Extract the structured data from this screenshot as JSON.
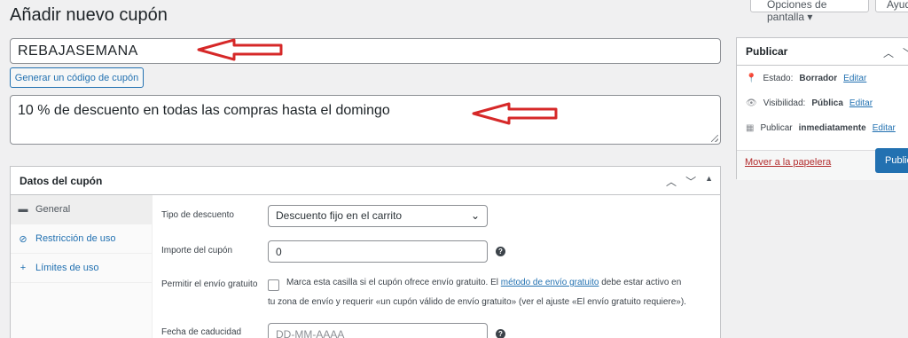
{
  "top": {
    "screen_options": "Opciones de pantalla ▾",
    "help": "Ayuda"
  },
  "page": {
    "title": "Añadir nuevo cupón",
    "coupon_code": "REBAJASEMANA",
    "generate_button": "Generar un código de cupón",
    "description": "10 % de descuento en todas las compras hasta el domingo"
  },
  "coupon_data": {
    "title": "Datos del cupón",
    "tabs": [
      {
        "label": "General",
        "icon": "ticket-icon",
        "glyph": "▬"
      },
      {
        "label": "Restricción de uso",
        "icon": "prohibited-icon",
        "glyph": "⊘"
      },
      {
        "label": "Límites de uso",
        "icon": "plus-icon",
        "glyph": "+"
      }
    ],
    "discount_type_label": "Tipo de descuento",
    "discount_type_value": "Descuento fijo en el carrito",
    "amount_label": "Importe del cupón",
    "amount_value": "0",
    "free_shipping_label": "Permitir el envío gratuito",
    "free_shipping_text_1": "Marca esta casilla si el cupón ofrece envío gratuito. El",
    "free_shipping_link": "método de envío gratuito",
    "free_shipping_text_2": "debe estar activo en",
    "free_shipping_text_3": "tu zona de envío y requerir «un cupón válido de envío gratuito» (ver el ajuste «El envío gratuito requiere»).",
    "expiry_label": "Fecha de caducidad",
    "expiry_placeholder": "DD-MM-AAAA"
  },
  "publish": {
    "title": "Publicar",
    "status_label": "Estado:",
    "status_value": "Borrador",
    "visibility_label": "Visibilidad:",
    "visibility_value": "Pública",
    "schedule_label": "Publicar",
    "schedule_value": "inmediatamente",
    "edit": "Editar",
    "trash": "Mover a la papelera",
    "publish_button": "Publicar"
  },
  "colors": {
    "accent": "#2271b1",
    "arrow": "#d62828",
    "trash": "#b32d2e"
  }
}
